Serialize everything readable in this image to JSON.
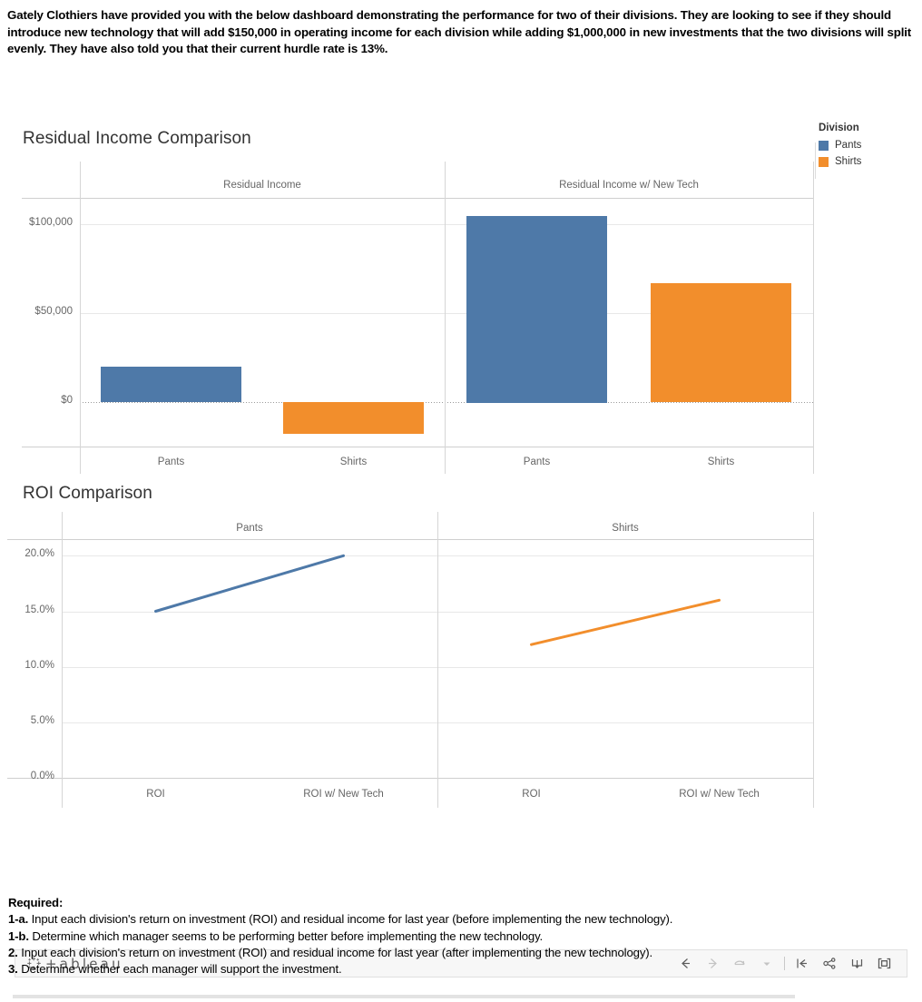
{
  "intro": {
    "text": "Gately Clothiers have provided you with the below dashboard demonstrating the performance for two of their divisions. They are looking to see if they should introduce new technology that will add $150,000 in operating income for each division while adding $1,000,000 in new investments that the two divisions will split evenly. They have also told you that their current hurdle rate is 13%."
  },
  "legend": {
    "title": "Division",
    "items": [
      {
        "label": "Pants",
        "color": "#4E79A8"
      },
      {
        "label": "Shirts",
        "color": "#F28E2C"
      }
    ]
  },
  "residual_income": {
    "title": "Residual Income Comparison",
    "panels": [
      "Residual Income",
      "Residual Income  w/ New Tech"
    ],
    "y_ticks": [
      "$100,000",
      "$50,000",
      "$0"
    ],
    "x_labels": [
      "Pants",
      "Shirts",
      "Pants",
      "Shirts"
    ]
  },
  "roi": {
    "title": "ROI Comparison",
    "panels": [
      "Pants",
      "Shirts"
    ],
    "y_ticks": [
      "20.0%",
      "15.0%",
      "10.0%",
      "5.0%",
      "0.0%"
    ],
    "x_labels": [
      "ROI",
      "ROI w/ New Tech",
      "ROI",
      "ROI w/ New Tech"
    ]
  },
  "toolbar": {
    "wordmark": "+ableau",
    "buttons": [
      {
        "name": "back",
        "glyph": "←"
      },
      {
        "name": "forward",
        "glyph": "→"
      },
      {
        "name": "revert",
        "glyph": "↻"
      },
      {
        "name": "revert-menu",
        "glyph": "▾"
      },
      {
        "name": "refresh",
        "glyph": "|←"
      },
      {
        "name": "share",
        "glyph": "share"
      },
      {
        "name": "download",
        "glyph": "download"
      },
      {
        "name": "fullscreen",
        "glyph": "fullscreen"
      }
    ]
  },
  "required": {
    "header": "Required:",
    "items": [
      {
        "label": "1-a.",
        "text": " Input each division's return on investment (ROI) and residual income for last year (before implementing the new technology)."
      },
      {
        "label": "1-b.",
        "text": " Determine which manager seems to be performing better before implementing the new technology."
      },
      {
        "label": "2.",
        "text": " Input each division's return on investment (ROI) and residual income for last year (after implementing the new technology)."
      },
      {
        "label": "3.",
        "text": " Determine whether each manager will support the investment."
      }
    ]
  },
  "chart_data": [
    {
      "type": "bar",
      "title": "Residual Income Comparison",
      "xlabel": "",
      "ylabel": "",
      "ylim": [
        -25000,
        115000
      ],
      "y_ticks": [
        0,
        50000,
        100000
      ],
      "y_tick_labels": [
        "$0",
        "$50,000",
        "$100,000"
      ],
      "grid": true,
      "legend_position": "right",
      "legend_title": "Division",
      "panels": [
        {
          "name": "Residual Income",
          "categories": [
            "Pants",
            "Shirts"
          ],
          "values": [
            20000,
            -18000
          ],
          "colors": [
            "#4E79A8",
            "#F28E2C"
          ]
        },
        {
          "name": "Residual Income  w/ New Tech",
          "categories": [
            "Pants",
            "Shirts"
          ],
          "values": [
            105000,
            67000
          ],
          "colors": [
            "#4E79A8",
            "#F28E2C"
          ]
        }
      ]
    },
    {
      "type": "line",
      "title": "ROI Comparison",
      "xlabel": "",
      "ylabel": "",
      "ylim": [
        0,
        21.5
      ],
      "y_ticks": [
        0.0,
        5.0,
        10.0,
        15.0,
        20.0
      ],
      "y_tick_labels": [
        "0.0%",
        "5.0%",
        "10.0%",
        "15.0%",
        "20.0%"
      ],
      "grid": true,
      "legend_position": "right",
      "legend_title": "Division",
      "panels": [
        {
          "name": "Pants",
          "x": [
            "ROI",
            "ROI w/ New Tech"
          ],
          "series": [
            {
              "name": "Pants",
              "values": [
                15.0,
                20.0
              ],
              "color": "#4E79A8"
            }
          ]
        },
        {
          "name": "Shirts",
          "x": [
            "ROI",
            "ROI w/ New Tech"
          ],
          "series": [
            {
              "name": "Shirts",
              "values": [
                12.0,
                16.0
              ],
              "color": "#F28E2C"
            }
          ]
        }
      ]
    }
  ]
}
